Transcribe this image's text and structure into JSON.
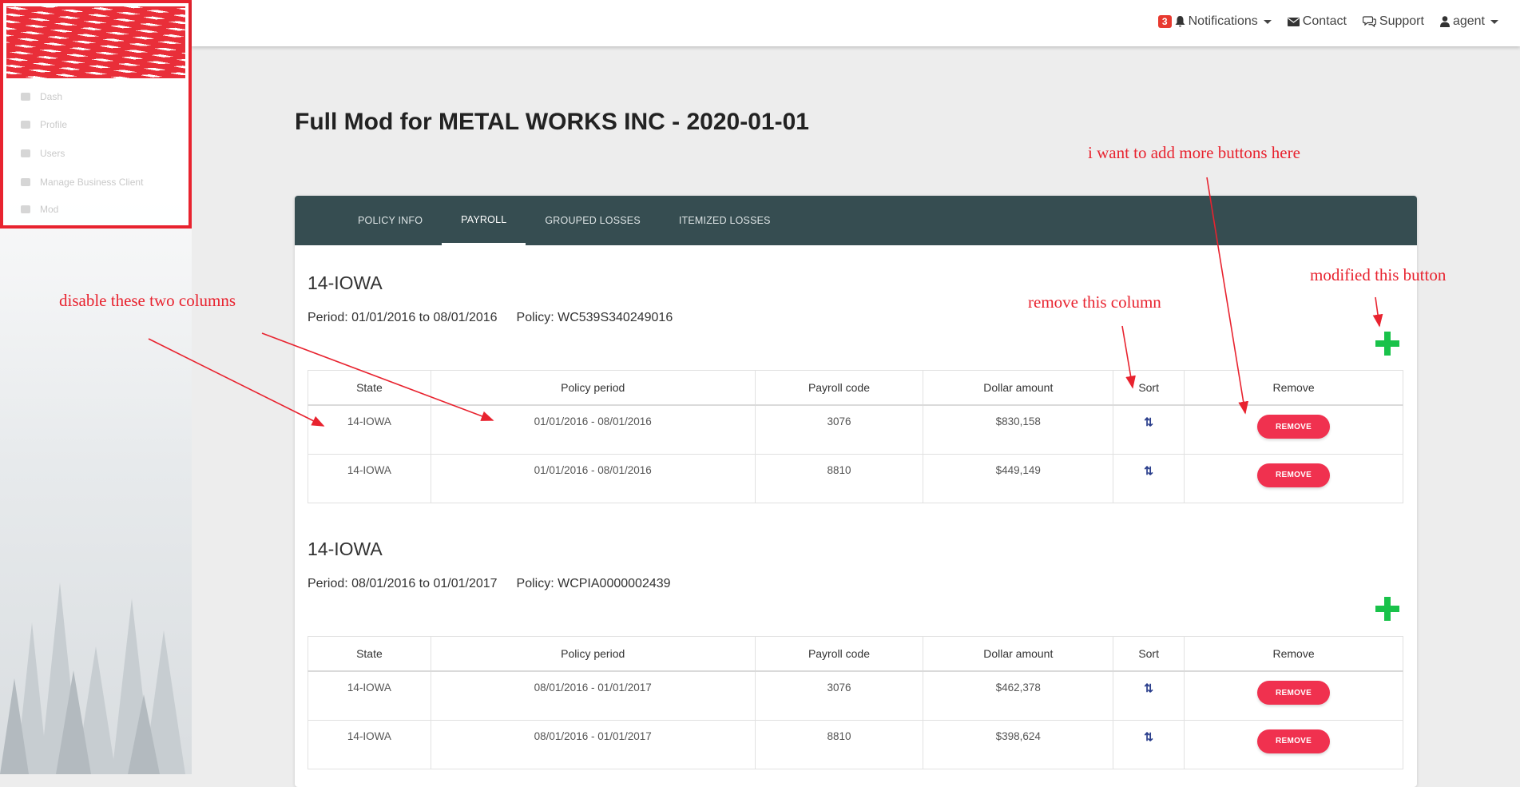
{
  "sidebar": {
    "items": [
      {
        "label": "Dash",
        "icon": "dashboard-icon"
      },
      {
        "label": "Profile",
        "icon": "user-icon"
      },
      {
        "label": "Users",
        "icon": "users-icon"
      },
      {
        "label": "Manage Business Client",
        "icon": "briefcase-icon"
      },
      {
        "label": "Mod",
        "icon": "list-icon"
      }
    ]
  },
  "topnav": {
    "notifications_count": "3",
    "notifications_label": "Notifications",
    "contact_label": "Contact",
    "support_label": "Support",
    "user_label": "agent"
  },
  "page": {
    "title": "Full Mod for METAL WORKS INC - 2020-01-01"
  },
  "tabs": [
    {
      "label": "POLICY INFO",
      "active": false
    },
    {
      "label": "PAYROLL",
      "active": true
    },
    {
      "label": "GROUPED LOSSES",
      "active": false
    },
    {
      "label": "ITEMIZED LOSSES",
      "active": false
    }
  ],
  "table_headers": [
    "State",
    "Policy period",
    "Payroll code",
    "Dollar amount",
    "Sort",
    "Remove"
  ],
  "remove_label": "REMOVE",
  "sort_glyph": "⇅",
  "sections": [
    {
      "title": "14-IOWA",
      "period": "Period: 01/01/2016 to 08/01/2016",
      "policy": "Policy: WC539S340249016",
      "rows": [
        {
          "state": "14-IOWA",
          "period": "01/01/2016 - 08/01/2016",
          "code": "3076",
          "amount": "$830,158"
        },
        {
          "state": "14-IOWA",
          "period": "01/01/2016 - 08/01/2016",
          "code": "8810",
          "amount": "$449,149"
        }
      ]
    },
    {
      "title": "14-IOWA",
      "period": "Period: 08/01/2016 to 01/01/2017",
      "policy": "Policy: WCPIA0000002439",
      "rows": [
        {
          "state": "14-IOWA",
          "period": "08/01/2016 - 01/01/2017",
          "code": "3076",
          "amount": "$462,378"
        },
        {
          "state": "14-IOWA",
          "period": "08/01/2016 - 01/01/2017",
          "code": "8810",
          "amount": "$398,624"
        }
      ]
    }
  ],
  "annotations": {
    "add_buttons": "i want to add more buttons here",
    "modified_button": "modified this button",
    "remove_column": "remove this column",
    "disable_columns": "disable these two columns"
  },
  "colors": {
    "accent_red": "#e8232f",
    "tab_bar": "#364d51",
    "add_green": "#19c24a",
    "remove_button": "#f0314f",
    "sort_blue": "#2a3e8c"
  }
}
